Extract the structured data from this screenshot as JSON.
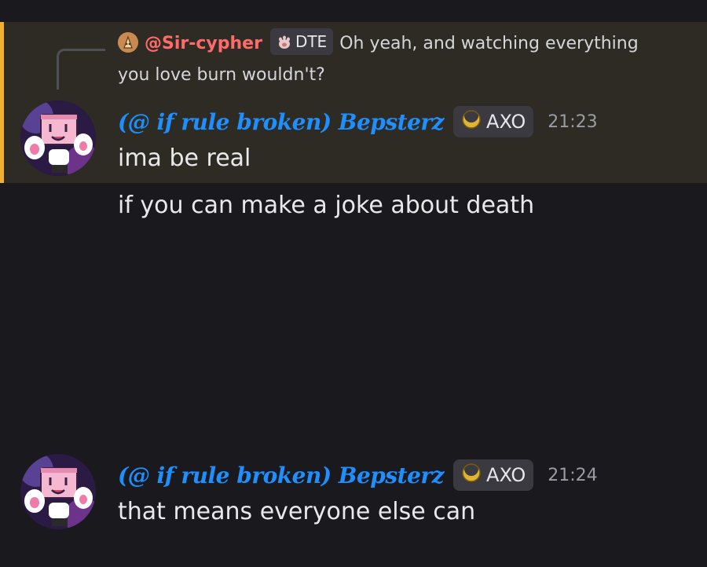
{
  "reply": {
    "author": "@Sir-cypher",
    "tag": "DTE",
    "text_line1": "Oh yeah, and watching everything",
    "text_line2": "you love burn wouldn't?"
  },
  "messages": [
    {
      "author": "(@ if rule broken) Bepsterz",
      "tag": "AXO",
      "time": "21:23",
      "lines": [
        "ima be real",
        "if you can make a joke about death"
      ]
    },
    {
      "author": "(@ if rule broken) Bepsterz",
      "tag": "AXO",
      "time": "21:24",
      "lines": [
        "that means everyone else can"
      ]
    }
  ],
  "colors": {
    "background": "#1a1a1e",
    "highlight": "#2e2b25",
    "highlight_bar": "#f0b132",
    "username": "#1e8fff",
    "reply_author": "#ff6b6b"
  },
  "icons": {
    "reply_avatar": "sir-cypher-avatar-icon",
    "dte_tag": "cat-paw-icon",
    "axo_tag": "crescent-moon-icon"
  }
}
